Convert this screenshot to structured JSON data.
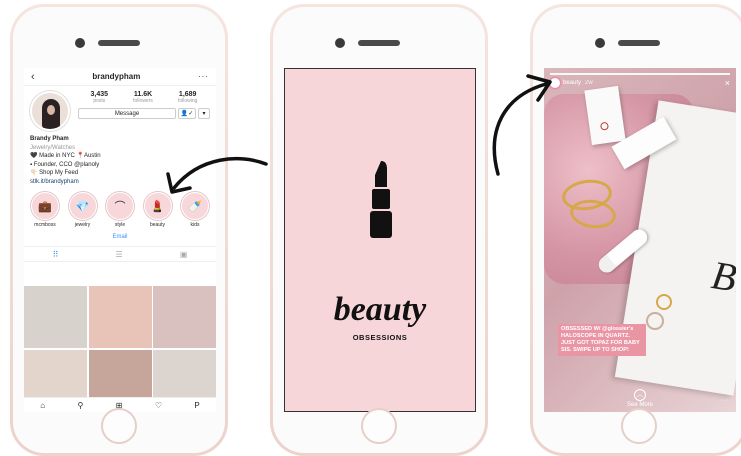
{
  "profile": {
    "username": "brandypham",
    "back_icon": "chevron-left-icon",
    "more_icon": "more-horizontal-icon",
    "stats": [
      {
        "value": "3,435",
        "label": "posts"
      },
      {
        "value": "11.6K",
        "label": "followers"
      },
      {
        "value": "1,689",
        "label": "following"
      }
    ],
    "message_label": "Message",
    "follow_icon": "person-check-icon",
    "dropdown_icon": "chevron-down-icon",
    "bio": {
      "name": "Brandy Pham",
      "category": "Jewelry/Watches",
      "line1": "🖤 Made in NYC 📍Austin",
      "line2": "▪ Founder, CCO @planoly",
      "line3": "👇🏻 Shop My Feed",
      "link": "stlk.it/brandypham"
    },
    "highlights": [
      {
        "label": "mcmboss",
        "icon": "briefcase-icon",
        "glyph": "💼"
      },
      {
        "label": "jewelry",
        "icon": "diamond-icon",
        "glyph": "💎"
      },
      {
        "label": "style",
        "icon": "hanger-icon",
        "glyph": "⌒"
      },
      {
        "label": "beauty",
        "icon": "lipstick-icon",
        "glyph": "💄"
      },
      {
        "label": "kids",
        "icon": "baby-bottle-icon",
        "glyph": "🍼"
      }
    ],
    "email_label": "Email",
    "tabs": [
      "grid-icon",
      "list-icon",
      "tagged-icon"
    ],
    "grid_colors": [
      "#d8d2cd",
      "#e7c3b8",
      "#d9c1bf",
      "#e4d5cc",
      "#c6a59a",
      "#dcd5cf",
      "#efe6e0",
      "#3a3432",
      "#f1e9ea"
    ],
    "nav": [
      "home-icon",
      "search-icon",
      "add-icon",
      "heart-icon",
      "profile-icon"
    ],
    "nav_profile_letter": "P"
  },
  "cover": {
    "icon": "lipstick-icon",
    "title": "beauty",
    "subtitle": "OBSESSIONS"
  },
  "story": {
    "username": "beauty",
    "time": "2w",
    "close_icon": "close-icon",
    "caption": "OBSESSED W/ @glossier's HALOSCOPE IN QUARTZ. JUST GOT TOPAZ FOR BABY SIS. SWIPE UP TO SHOP!",
    "see_more": "See More",
    "see_more_icon": "chevron-up-icon",
    "more_icon": "more-horizontal-icon",
    "paper_word": "Br"
  },
  "colors": {
    "phone_rose": "#ecd3cc",
    "cover_pink": "#f7d6d9",
    "instagram_blue": "#3897f0",
    "link_navy": "#1b3e6e"
  }
}
